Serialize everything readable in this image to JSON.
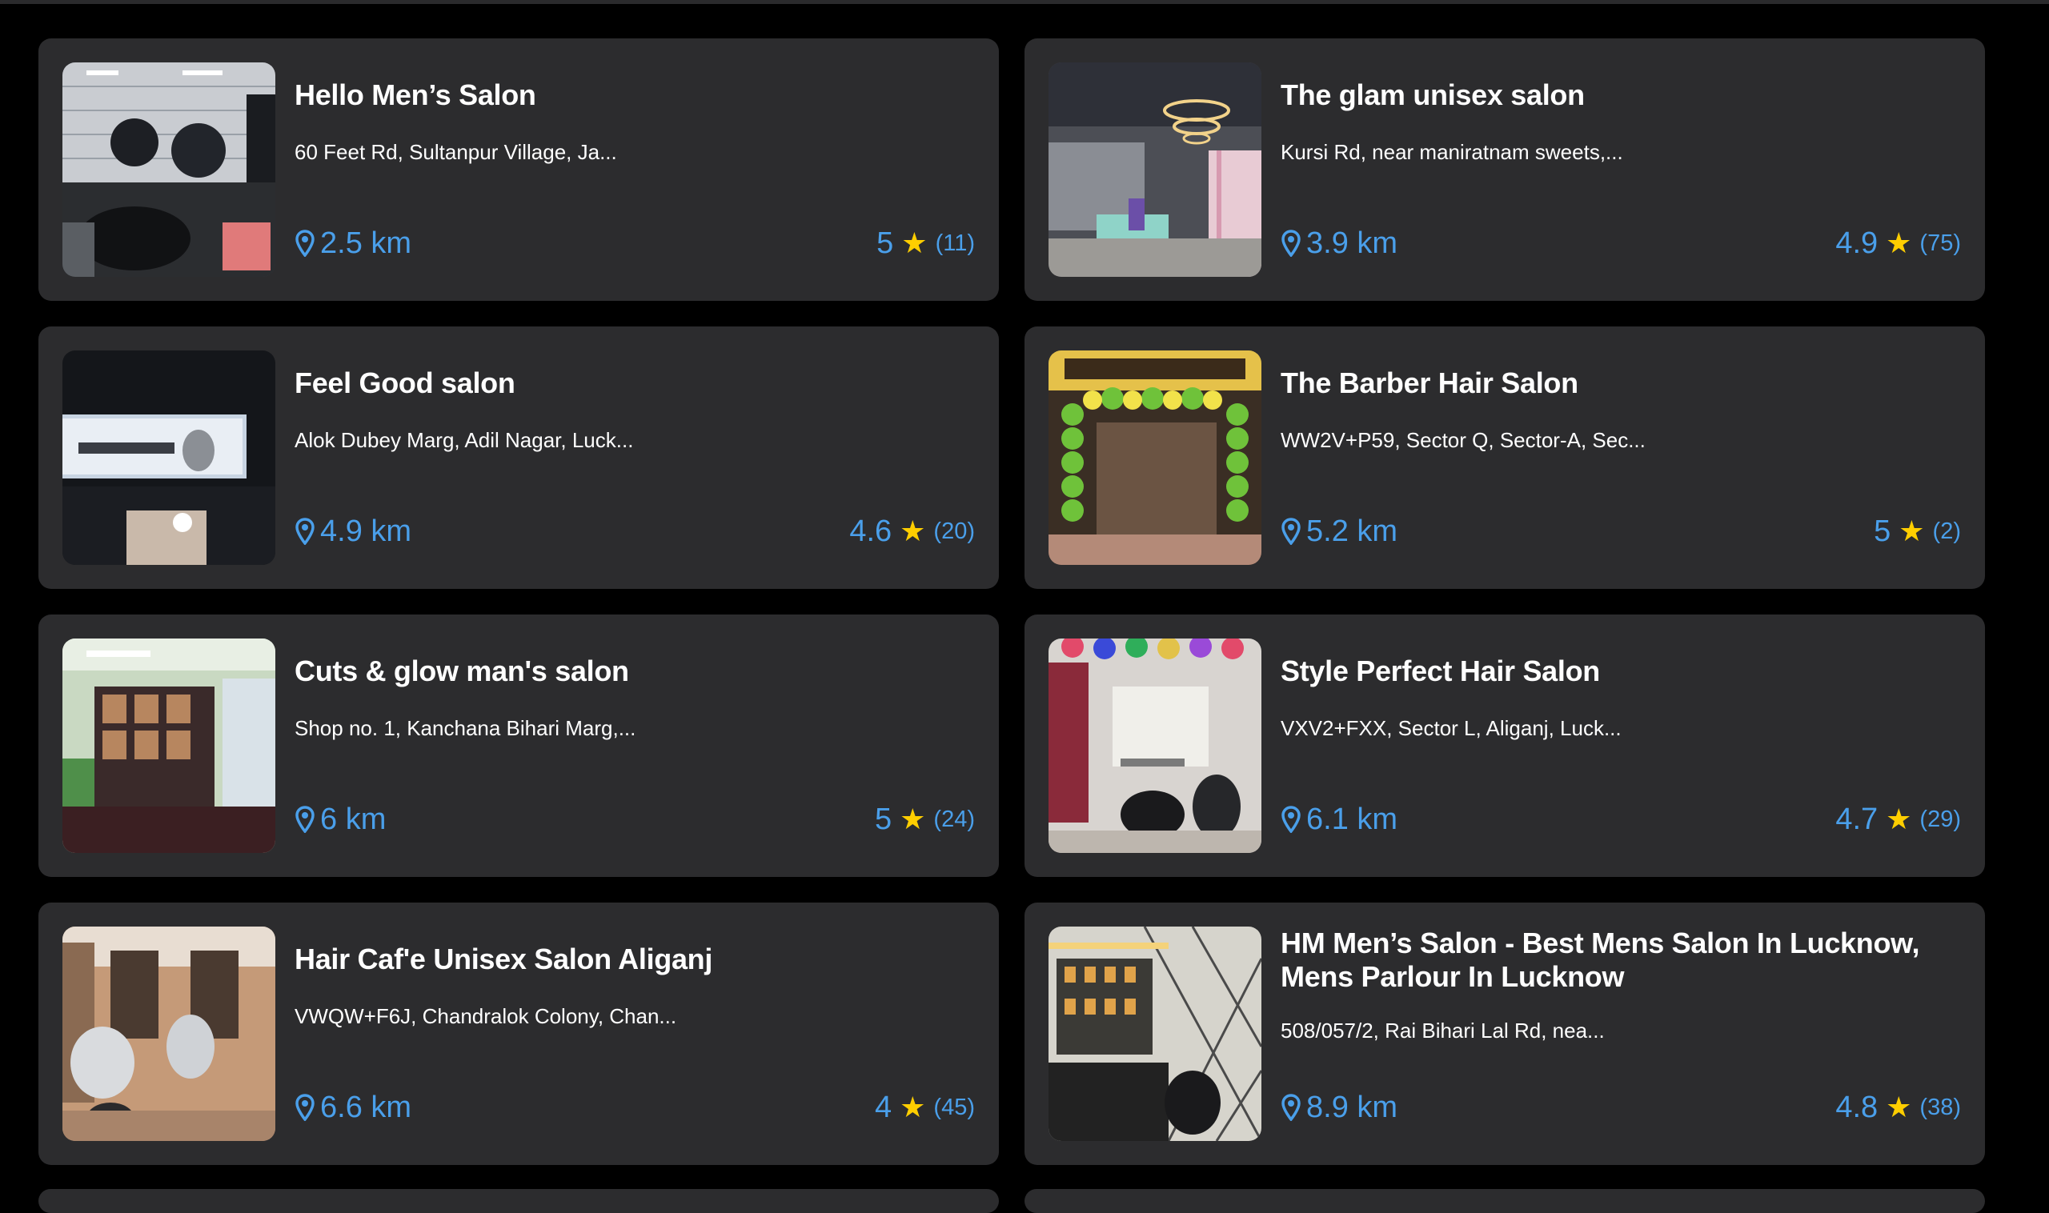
{
  "colors": {
    "background": "#000000",
    "card": "#2c2c2e",
    "accent": "#4a9fea",
    "star": "#ffce00",
    "text": "#ffffff"
  },
  "icons": {
    "distance": "map-pin-icon",
    "rating": "star-icon"
  },
  "salons": [
    {
      "name": "Hello Men’s Salon",
      "address": "60 Feet Rd, Sultanpur Village, Ja...",
      "distance": "2.5 km",
      "rating": "5",
      "star": "★",
      "reviews": "(11)"
    },
    {
      "name": "The glam unisex salon",
      "address": "Kursi Rd, near maniratnam sweets,...",
      "distance": "3.9 km",
      "rating": "4.9",
      "star": "★",
      "reviews": "(75)"
    },
    {
      "name": "Feel Good salon",
      "address": "Alok Dubey Marg, Adil Nagar, Luck...",
      "distance": "4.9 km",
      "rating": "4.6",
      "star": "★",
      "reviews": "(20)"
    },
    {
      "name": "The Barber Hair Salon",
      "address": "WW2V+P59, Sector Q, Sector-A, Sec...",
      "distance": "5.2 km",
      "rating": "5",
      "star": "★",
      "reviews": "(2)"
    },
    {
      "name": "Cuts & glow man's salon",
      "address": "Shop no. 1, Kanchana Bihari Marg,...",
      "distance": "6 km",
      "rating": "5",
      "star": "★",
      "reviews": "(24)"
    },
    {
      "name": "Style Perfect Hair Salon",
      "address": "VXV2+FXX, Sector L, Aliganj, Luck...",
      "distance": "6.1 km",
      "rating": "4.7",
      "star": "★",
      "reviews": "(29)"
    },
    {
      "name": "Hair Caf'e Unisex Salon Aliganj",
      "address": "VWQW+F6J, Chandralok Colony, Chan...",
      "distance": "6.6 km",
      "rating": "4",
      "star": "★",
      "reviews": "(45)"
    },
    {
      "name": "HM Men’s Salon - Best Mens Salon In Lucknow, Mens Parlour In Lucknow",
      "address": "508/057/2, Rai Bihari Lal Rd, nea...",
      "distance": "8.9 km",
      "rating": "4.8",
      "star": "★",
      "reviews": "(38)"
    }
  ]
}
